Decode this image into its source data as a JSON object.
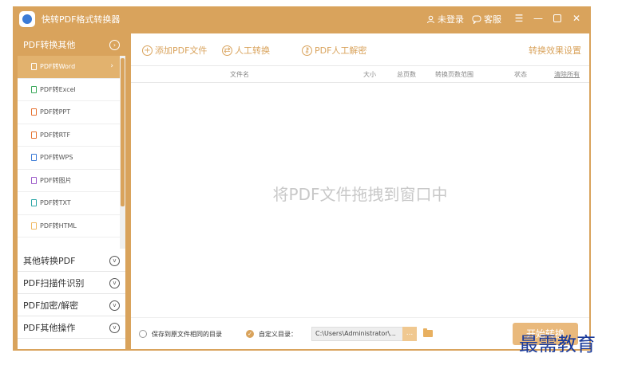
{
  "app": {
    "title": "快转PDF格式转换器"
  },
  "titlebar": {
    "login": "未登录",
    "service": "客服"
  },
  "sidebar": {
    "active_category": "PDF转换其他",
    "sub_items": [
      {
        "label": "PDF转Word",
        "color": "#e49a3a"
      },
      {
        "label": "PDF转Excel",
        "color": "#3aa85a"
      },
      {
        "label": "PDF转PPT",
        "color": "#e6702e"
      },
      {
        "label": "PDF转RTF",
        "color": "#e6702e"
      },
      {
        "label": "PDF转WPS",
        "color": "#3b7bd6"
      },
      {
        "label": "PDF转图片",
        "color": "#9b59c9"
      },
      {
        "label": "PDF转TXT",
        "color": "#2aa6a6"
      },
      {
        "label": "PDF转HTML",
        "color": "#f0b860"
      }
    ],
    "categories": [
      "其他转换PDF",
      "PDF扫描件识别",
      "PDF加密/解密",
      "PDF其他操作"
    ]
  },
  "toolbar": {
    "add_file": "添加PDF文件",
    "manual_convert": "人工转换",
    "manual_decrypt": "PDF人工解密",
    "settings": "转换效果设置"
  },
  "table": {
    "headers": {
      "filename": "文件名",
      "size": "大小",
      "pages": "总页数",
      "range": "转换页数范围",
      "status": "状态",
      "clear": "清除所有"
    }
  },
  "main": {
    "empty_hint": "将PDF文件拖拽到窗口中"
  },
  "footer": {
    "option_same_dir": "保存到原文件相同的目录",
    "option_custom": "自定义目录：",
    "path": "C:\\Users\\Administrator\\...",
    "browse": "...",
    "convert": "开始转换"
  },
  "watermark": "最需教育"
}
